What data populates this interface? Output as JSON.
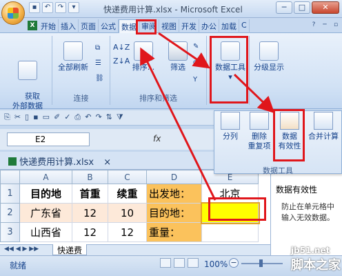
{
  "window": {
    "title": "快递费用计算.xlsx - Microsoft Excel",
    "controls": [
      "─",
      "□",
      "✕"
    ]
  },
  "tabs": [
    "开始",
    "插入",
    "页面",
    "公式",
    "数据",
    "审阅",
    "视图",
    "开发",
    "办公",
    "加载",
    "C"
  ],
  "active_tab_index": 4,
  "ribbon": {
    "get_external": "获取\n外部数据",
    "refresh_all": "全部刷新",
    "connections_group": "连接",
    "sort": "排序...",
    "filter": "筛选",
    "sort_filter_group": "排序和筛选",
    "data_tools": "数据工具",
    "outline": "分级显示"
  },
  "popup": {
    "split": "分列",
    "remove_dup_1": "删除",
    "remove_dup_2": "重复项",
    "validation_1": "数据",
    "validation_2": "有效性",
    "merge_calc": "合并计算",
    "group_label": "数据工具"
  },
  "namebox": "E2",
  "fx": "fx",
  "doc_tab": "快递费用计算.xlsx",
  "sheet": {
    "columns": [
      "A",
      "B",
      "C",
      "D",
      "E"
    ],
    "rows": [
      {
        "num": "1",
        "cells": [
          "目的地",
          "首重",
          "续重",
          "出发地：",
          "北京"
        ]
      },
      {
        "num": "2",
        "cells": [
          "广东省",
          "12",
          "10",
          "目的地：",
          ""
        ]
      },
      {
        "num": "3",
        "cells": [
          "山西省",
          "12",
          "12",
          "重量：",
          ""
        ]
      }
    ],
    "sheet_tab": "快递费"
  },
  "task_pane": {
    "title": "数据有效性",
    "body": "防止在单元格中输入无效数据。"
  },
  "status": {
    "ready": "就绪",
    "zoom": "100%"
  },
  "watermark": {
    "line1": "jb51.net",
    "line2": "脚本之家"
  },
  "colors": {
    "highlight_red": "#e0161b",
    "orange_cell": "#fbc25c",
    "yellow_cell": "#ffff00"
  }
}
